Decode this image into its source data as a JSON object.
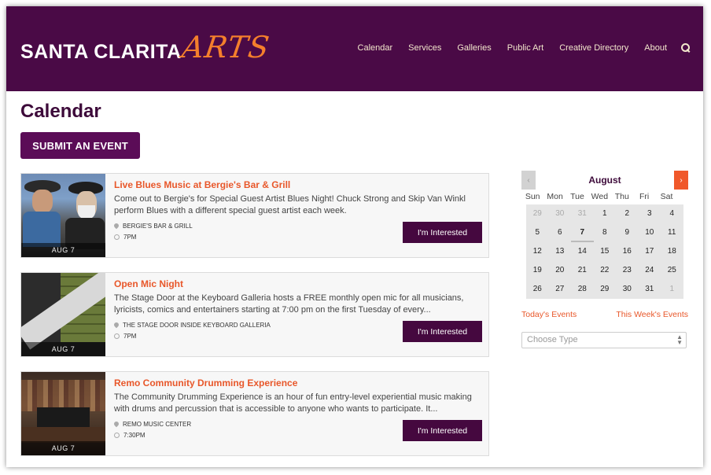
{
  "header": {
    "logo_main": "SANTA CLARITA",
    "logo_accent": "ARTS",
    "nav": [
      "Calendar",
      "Services",
      "Galleries",
      "Public Art",
      "Creative Directory",
      "About"
    ]
  },
  "page": {
    "title": "Calendar",
    "submit_label": "SUBMIT AN EVENT"
  },
  "events": [
    {
      "title": "Live Blues Music at Bergie's Bar & Grill",
      "description": "Come out to Bergie's for Special Guest Artist Blues Night! Chuck Strong and Skip Van Winkl perform Blues with a different special guest artist each week.",
      "venue": "BERGIE'S BAR & GRILL",
      "time": "7PM",
      "date": "AUG 7",
      "button": "I'm Interested"
    },
    {
      "title": "Open Mic Night",
      "description": "The Stage Door at the Keyboard Galleria hosts a FREE monthly open mic for all musicians, lyricists, comics and entertainers starting at 7:00 pm on the first Tuesday of every...",
      "venue": "THE STAGE DOOR INSIDE KEYBOARD GALLERIA",
      "time": "7PM",
      "date": "AUG 7",
      "button": "I'm Interested"
    },
    {
      "title": "Remo Community Drumming Experience",
      "description": "The Community Drumming Experience is an hour of fun entry-level experiential music making with drums and percussion that is accessible to anyone who wants to participate. It...",
      "venue": "REMO MUSIC CENTER",
      "time": "7:30PM",
      "date": "AUG 7",
      "button": "I'm Interested"
    }
  ],
  "calendar": {
    "month": "August",
    "prev": "‹",
    "next": "›",
    "weekdays": [
      "Sun",
      "Mon",
      "Tue",
      "Wed",
      "Thu",
      "Fri",
      "Sat"
    ],
    "weeks": [
      [
        "29",
        "30",
        "31",
        "1",
        "2",
        "3",
        "4"
      ],
      [
        "5",
        "6",
        "7",
        "8",
        "9",
        "10",
        "11"
      ],
      [
        "12",
        "13",
        "14",
        "15",
        "16",
        "17",
        "18"
      ],
      [
        "19",
        "20",
        "21",
        "22",
        "23",
        "24",
        "25"
      ],
      [
        "26",
        "27",
        "28",
        "29",
        "30",
        "31",
        "1"
      ]
    ],
    "today_link": "Today's Events",
    "week_link": "This Week's Events",
    "type_placeholder": "Choose Type"
  },
  "colors": {
    "header_bg": "#4a0a46",
    "accent": "#e8572a",
    "button": "#45083f"
  }
}
